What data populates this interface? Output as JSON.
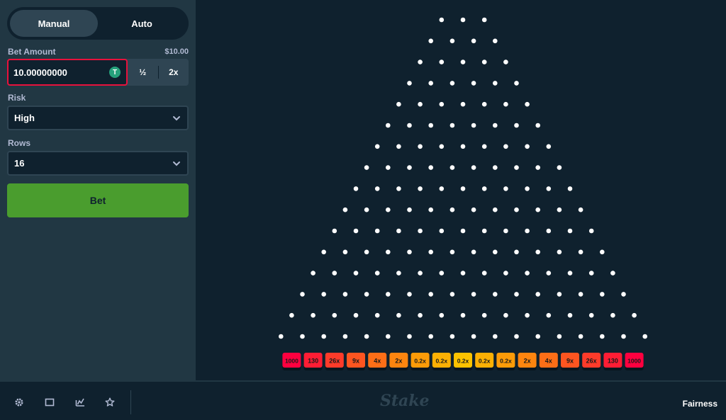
{
  "mode_tabs": {
    "manual": "Manual",
    "auto": "Auto"
  },
  "bet_amount": {
    "label": "Bet Amount",
    "usd_value": "$10.00",
    "value": "10.00000000",
    "currency_symbol": "T",
    "half_label": "½",
    "double_label": "2x"
  },
  "risk": {
    "label": "Risk",
    "value": "High"
  },
  "rows": {
    "label": "Rows",
    "value": "16"
  },
  "bet_button": {
    "label": "Bet"
  },
  "multipliers": [
    "1000",
    "130",
    "26x",
    "9x",
    "4x",
    "2x",
    "0.2x",
    "0.2x",
    "0.2x",
    "0.2x",
    "0.2x",
    "2x",
    "4x",
    "9x",
    "26x",
    "130",
    "1000"
  ],
  "multiplier_colors": [
    "#ff003f",
    "#ff1d34",
    "#fe3b2a",
    "#fe5520",
    "#fd6e17",
    "#fd850f",
    "#fc9b08",
    "#fcb004",
    "#fcc200",
    "#fcb004",
    "#fc9b08",
    "#fd850f",
    "#fd6e17",
    "#fe5520",
    "#fe3b2a",
    "#ff1d34",
    "#ff003f"
  ],
  "footer": {
    "logo": "Stake",
    "fairness": "Fairness",
    "icons": [
      "gear-icon",
      "theatre-mode-icon",
      "stats-icon",
      "star-icon"
    ]
  },
  "colors": {
    "bg": "#0f212e",
    "panel": "#213743",
    "accent_green": "#4a9d2e",
    "input_error": "#e9113c"
  }
}
